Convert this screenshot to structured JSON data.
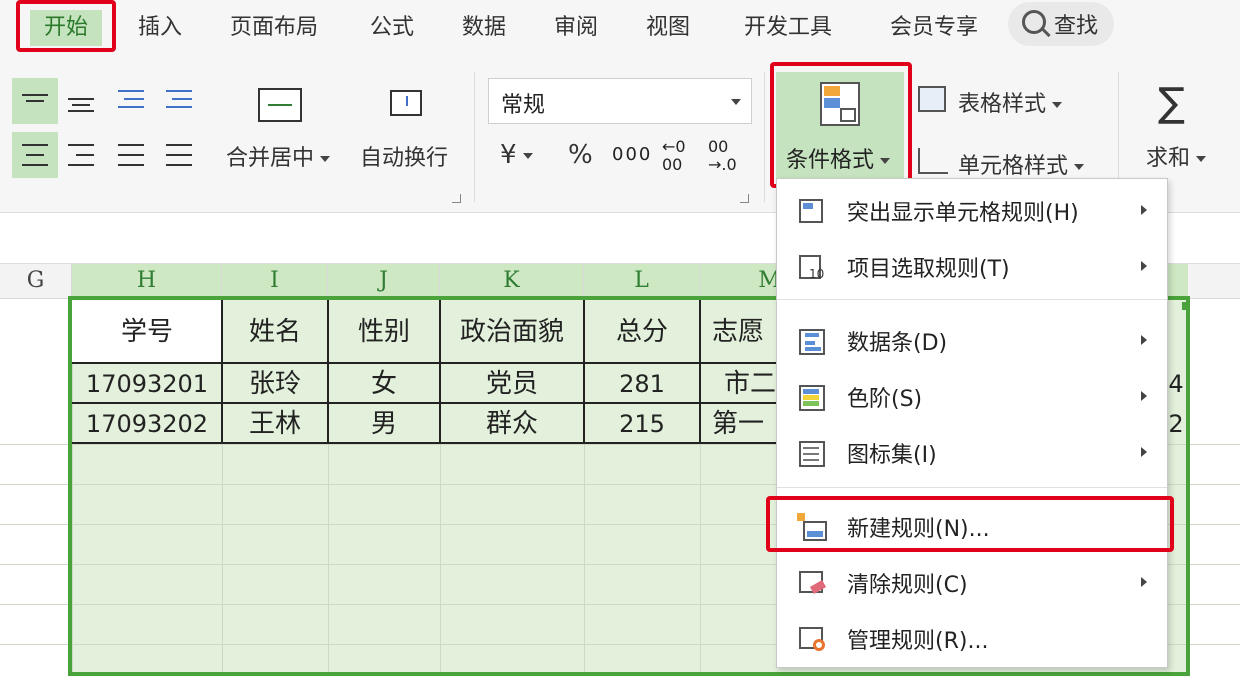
{
  "menubar": {
    "tabs": [
      "开始",
      "插入",
      "页面布局",
      "公式",
      "数据",
      "审阅",
      "视图",
      "开发工具",
      "会员专享"
    ],
    "search_label": "查找"
  },
  "ribbon": {
    "merge_label": "合并居中",
    "wrap_label": "自动换行",
    "number_format": "常规",
    "currency_symbol": "¥",
    "percent_symbol": "%",
    "thousands_symbol": "000",
    "dec_increase": "←0\n00",
    "dec_decrease": "00\n→.0",
    "cond_format_label": "条件格式",
    "table_style_label": "表格样式",
    "cell_style_label": "单元格样式",
    "sum_label": "求和",
    "sum_symbol": "∑"
  },
  "sheet": {
    "columns": [
      "G",
      "H",
      "I",
      "J",
      "K",
      "L",
      "M"
    ],
    "headers": [
      "学号",
      "姓名",
      "性别",
      "政治面貌",
      "总分",
      "志愿"
    ],
    "rows": [
      [
        "17093201",
        "张玲",
        "女",
        "党员",
        "281",
        "市二"
      ],
      [
        "17093202",
        "王林",
        "男",
        "群众",
        "215",
        "第一"
      ]
    ],
    "right_edge_values": [
      "4",
      "2"
    ]
  },
  "cond_menu": {
    "items": [
      {
        "label": "突出显示单元格规则(H)",
        "submenu": true,
        "icon": "highlight-cells-icon"
      },
      {
        "label": "项目选取规则(T)",
        "submenu": true,
        "icon": "top-bottom-icon"
      },
      {
        "label": "数据条(D)",
        "submenu": true,
        "icon": "data-bars-icon"
      },
      {
        "label": "色阶(S)",
        "submenu": true,
        "icon": "color-scale-icon"
      },
      {
        "label": "图标集(I)",
        "submenu": true,
        "icon": "icon-sets-icon"
      },
      {
        "label": "新建规则(N)...",
        "submenu": false,
        "icon": "new-rule-icon"
      },
      {
        "label": "清除规则(C)",
        "submenu": true,
        "icon": "clear-rules-icon"
      },
      {
        "label": "管理规则(R)...",
        "submenu": false,
        "icon": "manage-rules-icon"
      }
    ]
  },
  "colors": {
    "accent_green": "#c5e3bf",
    "selection_border": "#4aa33a",
    "highlight_red": "#e0001a"
  }
}
